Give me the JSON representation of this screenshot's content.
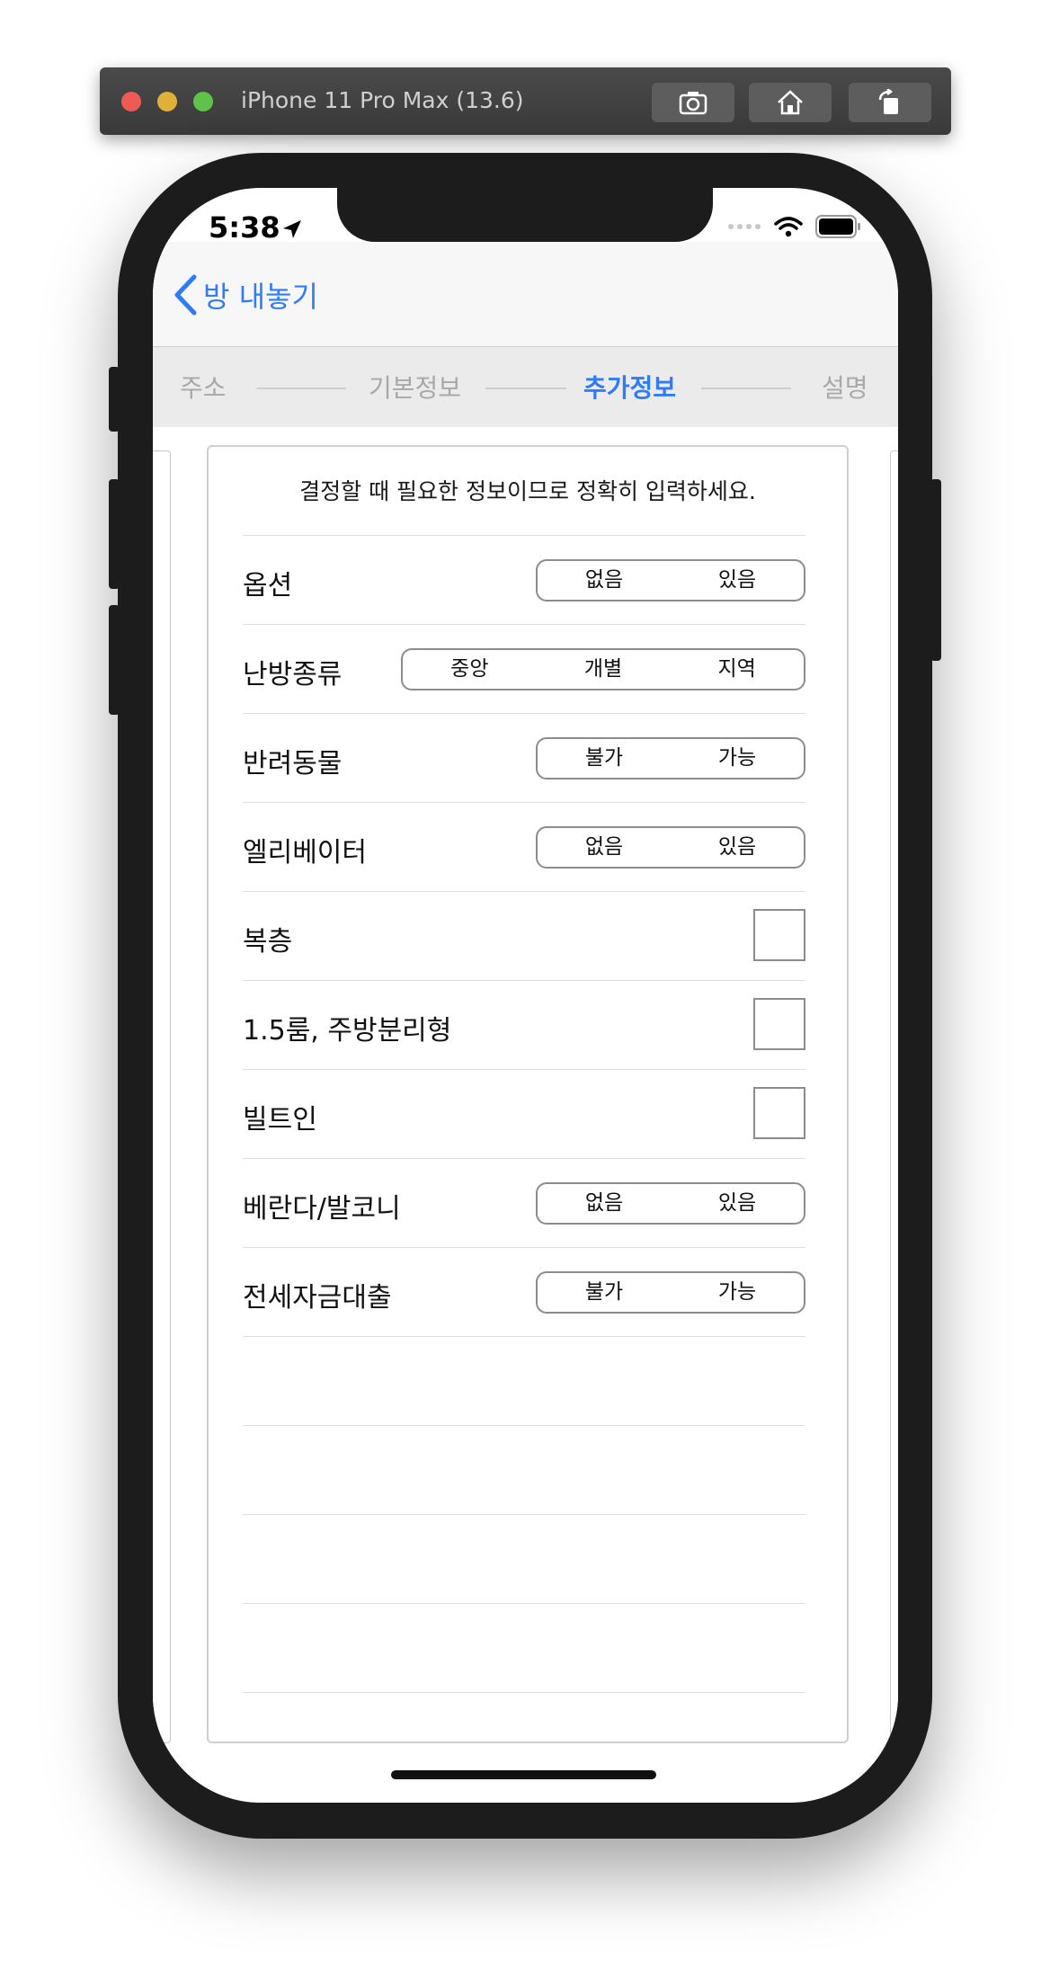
{
  "simulator": {
    "title": "iPhone 11 Pro Max (13.6)",
    "buttons": [
      "screenshot-icon",
      "home-icon",
      "rotate-icon"
    ]
  },
  "status_bar": {
    "time": "5:38"
  },
  "nav": {
    "back_label": "방 내놓기"
  },
  "steps": {
    "items": [
      "주소",
      "기본정보",
      "추가정보",
      "설명"
    ],
    "active": "추가정보"
  },
  "form": {
    "instruction": "결정할 때 필요한 정보이므로 정확히 입력하세요.",
    "rows": [
      {
        "label": "옵션",
        "options": [
          "없음",
          "있음"
        ]
      },
      {
        "label": "난방종류",
        "options": [
          "중앙",
          "개별",
          "지역"
        ]
      },
      {
        "label": "반려동물",
        "options": [
          "불가",
          "가능"
        ]
      },
      {
        "label": "엘리베이터",
        "options": [
          "없음",
          "있음"
        ]
      },
      {
        "label": "복층"
      },
      {
        "label": "1.5룸, 주방분리형"
      },
      {
        "label": "빌트인"
      },
      {
        "label": "베란다/발코니",
        "options": [
          "없음",
          "있음"
        ]
      },
      {
        "label": "전세자금대출",
        "options": [
          "불가",
          "가능"
        ]
      }
    ]
  },
  "colors": {
    "accent": "#2f7cf6",
    "inactive_step": "#a8a8a8"
  }
}
